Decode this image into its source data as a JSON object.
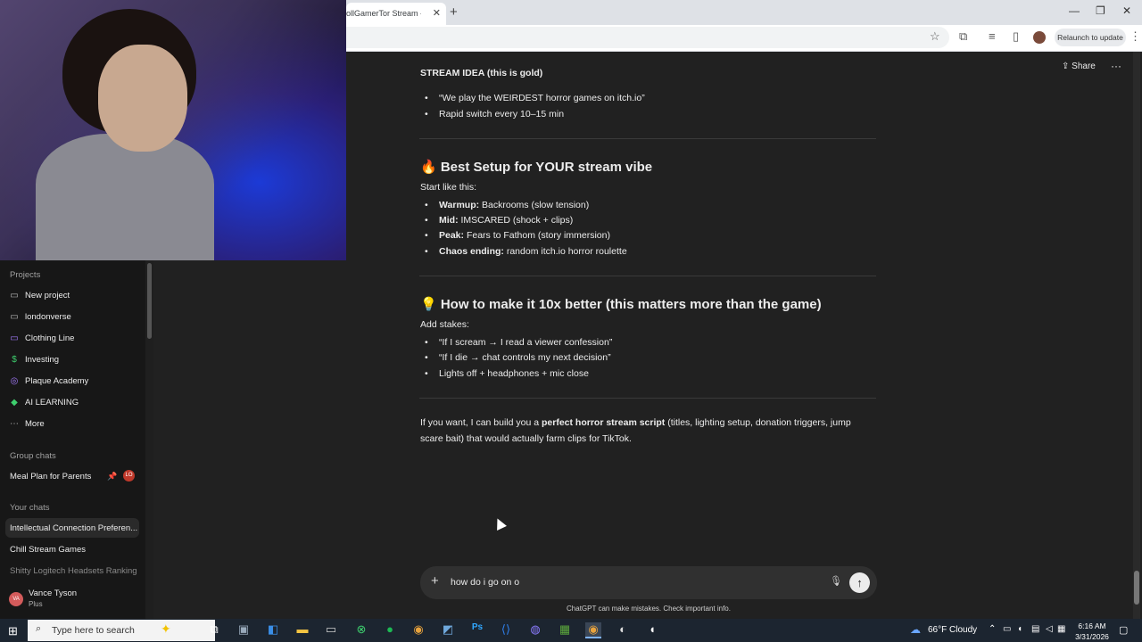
{
  "browser": {
    "tab_title": "ollGamerTor Stream - W",
    "relaunch_label": "Relaunch to update"
  },
  "header": {
    "share_label": "Share"
  },
  "sidebar": {
    "projects_heading": "Projects",
    "projects": [
      {
        "label": "New project",
        "icon": "new-project-icon"
      },
      {
        "label": "londonverse",
        "icon": "folder-icon"
      },
      {
        "label": "Clothing Line",
        "icon": "folder-purple-icon"
      },
      {
        "label": "Investing",
        "icon": "dollar-icon"
      },
      {
        "label": "Plaque Academy",
        "icon": "globe-icon"
      },
      {
        "label": "AI LEARNING",
        "icon": "graduation-cap-icon"
      },
      {
        "label": "More",
        "icon": "ellipsis-icon"
      }
    ],
    "group_heading": "Group chats",
    "group_chat": {
      "label": "Meal Plan for Parents",
      "badge": "LO"
    },
    "chats_heading": "Your chats",
    "chats": [
      {
        "label": "Intellectual Connection Preferen..."
      },
      {
        "label": "Chill Stream Games"
      },
      {
        "label": "Shitty Logitech Headsets Ranking"
      }
    ],
    "user": {
      "initials": "VA",
      "name": "Vance Tyson",
      "plan": "Plus"
    }
  },
  "content": {
    "stream_idea_heading": "STREAM IDEA (this is gold)",
    "stream_idea_bullets": [
      "“We play the WEIRDEST horror games on itch.io”",
      "Rapid switch every 10–15 min"
    ],
    "setup_heading": "🔥 Best Setup for YOUR stream vibe",
    "setup_intro": "Start like this:",
    "setup_bullets": [
      {
        "label": "Warmup:",
        "text": " Backrooms (slow tension)"
      },
      {
        "label": "Mid:",
        "text": " IMSCARED (shock + clips)"
      },
      {
        "label": "Peak:",
        "text": " Fears to Fathom (story immersion)"
      },
      {
        "label": "Chaos ending:",
        "text": " random itch.io horror roulette"
      }
    ],
    "better_heading": "💡 How to make it 10x better (this matters more than the game)",
    "better_intro": "Add stakes:",
    "better_bullets": [
      "“If I scream → I read a viewer confession”",
      "“If I die → chat controls my next decision”",
      "Lights off + headphones + mic close"
    ],
    "closing_pre": "If you want, I can build you a ",
    "closing_bold": "perfect horror stream script",
    "closing_post": " (titles, lighting setup, donation triggers, jump",
    "closing_line2": "scare bait) that would actually farm clips for TikTok."
  },
  "composer": {
    "value": "how do i go on o",
    "disclaimer": "ChatGPT can make mistakes. Check important info."
  },
  "taskbar": {
    "search_placeholder": "Type here to search",
    "weather": "66°F  Cloudy",
    "time": "6:16 AM",
    "date": "3/31/2026"
  }
}
